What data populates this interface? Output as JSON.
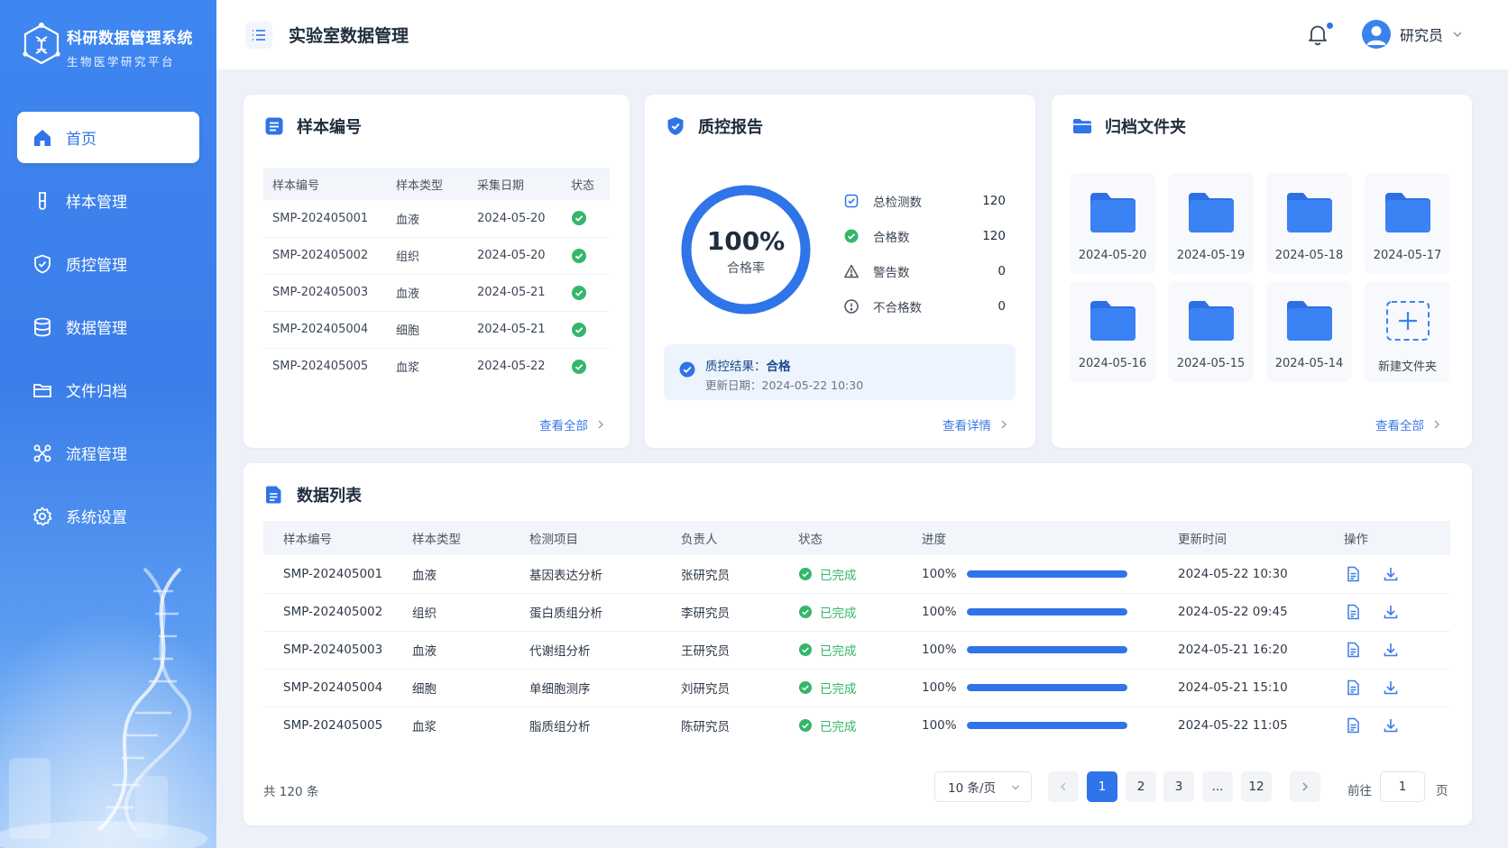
{
  "brand": {
    "title": "科研数据管理系统",
    "subtitle": "生物医学研究平台"
  },
  "sidebar": {
    "items": [
      {
        "label": "首页",
        "icon": "home-icon",
        "active": true
      },
      {
        "label": "样本管理",
        "icon": "test-tube-icon"
      },
      {
        "label": "质控管理",
        "icon": "shield-check-icon"
      },
      {
        "label": "数据管理",
        "icon": "database-icon"
      },
      {
        "label": "文件归档",
        "icon": "folder-icon"
      },
      {
        "label": "流程管理",
        "icon": "workflow-icon"
      },
      {
        "label": "系统设置",
        "icon": "gear-icon"
      }
    ]
  },
  "header": {
    "title": "实验室数据管理",
    "user": "研究员"
  },
  "samples": {
    "title": "样本编号",
    "columns": [
      "样本编号",
      "样本类型",
      "采集日期",
      "状态"
    ],
    "rows": [
      [
        "SMP-202405001",
        "血液",
        "2024-05-20"
      ],
      [
        "SMP-202405002",
        "组织",
        "2024-05-20"
      ],
      [
        "SMP-202405003",
        "血液",
        "2024-05-21"
      ],
      [
        "SMP-202405004",
        "细胞",
        "2024-05-21"
      ],
      [
        "SMP-202405005",
        "血浆",
        "2024-05-22"
      ]
    ],
    "more": "查看全部"
  },
  "qc": {
    "title": "质控报告",
    "rate": "100%",
    "rate_value": 1.0,
    "rate_label": "合格率",
    "stats": [
      {
        "label": "总检测数",
        "value": "120",
        "icon": "checkbox-icon"
      },
      {
        "label": "合格数",
        "value": "120",
        "icon": "check-circle-icon"
      },
      {
        "label": "警告数",
        "value": "0",
        "icon": "warning-icon"
      },
      {
        "label": "不合格数",
        "value": "0",
        "icon": "error-circle-icon"
      }
    ],
    "result_label": "质控结果：",
    "result_value": "合格",
    "updated": "更新日期：2024-05-22 10:30",
    "more": "查看详情"
  },
  "archive": {
    "title": "归档文件夹",
    "folders": [
      "2024-05-20",
      "2024-05-19",
      "2024-05-18",
      "2024-05-17",
      "2024-05-16",
      "2024-05-15",
      "2024-05-14"
    ],
    "new_folder": "新建文件夹",
    "more": "查看全部"
  },
  "datalist": {
    "title": "数据列表",
    "columns": [
      "样本编号",
      "样本类型",
      "检测项目",
      "负责人",
      "状态",
      "进度",
      "更新时间",
      "操作"
    ],
    "rows": [
      {
        "id": "SMP-202405001",
        "type": "血液",
        "item": "基因表达分析",
        "owner": "张研究员",
        "status": "已完成",
        "progress": "100%",
        "progress_value": 100,
        "time": "2024-05-22 10:30"
      },
      {
        "id": "SMP-202405002",
        "type": "组织",
        "item": "蛋白质组分析",
        "owner": "李研究员",
        "status": "已完成",
        "progress": "100%",
        "progress_value": 100,
        "time": "2024-05-22 09:45"
      },
      {
        "id": "SMP-202405003",
        "type": "血液",
        "item": "代谢组分析",
        "owner": "王研究员",
        "status": "已完成",
        "progress": "100%",
        "progress_value": 100,
        "time": "2024-05-21 16:20"
      },
      {
        "id": "SMP-202405004",
        "type": "细胞",
        "item": "单细胞测序",
        "owner": "刘研究员",
        "status": "已完成",
        "progress": "100%",
        "progress_value": 100,
        "time": "2024-05-21 15:10"
      },
      {
        "id": "SMP-202405005",
        "type": "血浆",
        "item": "脂质组分析",
        "owner": "陈研究员",
        "status": "已完成",
        "progress": "100%",
        "progress_value": 100,
        "time": "2024-05-22 11:05"
      }
    ]
  },
  "pagination": {
    "total": "共 120 条",
    "page_size": "10 条/页",
    "pages": [
      "1",
      "2",
      "3",
      "...",
      "12"
    ],
    "current": "1",
    "goto_prefix": "前往",
    "goto_value": "1",
    "goto_suffix": "页"
  },
  "colors": {
    "primary": "#2f74e8",
    "success": "#35b66b",
    "sidebar": "#3f86f0"
  }
}
